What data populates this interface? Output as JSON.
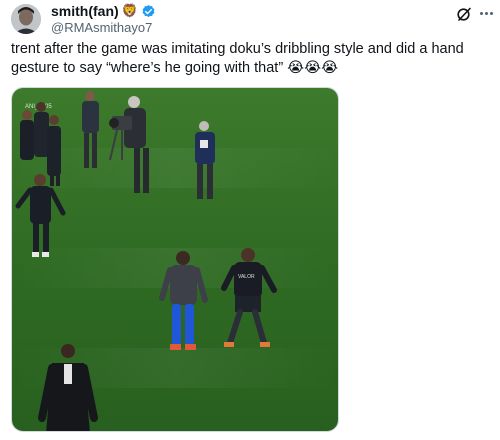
{
  "author": {
    "display_name": "smith(fan)",
    "handle": "@RMAsmithayo7",
    "badge_emoji": "🦁",
    "verified_color": "#1d9bf0"
  },
  "tweet": {
    "text": "trent after the game was imitating doku’s dribbling style and did a hand gesture to say “where’s he going with that” 😭😭😭"
  },
  "media": {
    "watermark": "ANI_1905",
    "kit_text_left": "VALOR",
    "kit_text_right": "VALOR",
    "pitch_color": "#2f6b23"
  },
  "icons": [
    "avatar",
    "lion-emoji-icon",
    "verified-badge-icon",
    "grok-icon",
    "more-options-icon"
  ]
}
